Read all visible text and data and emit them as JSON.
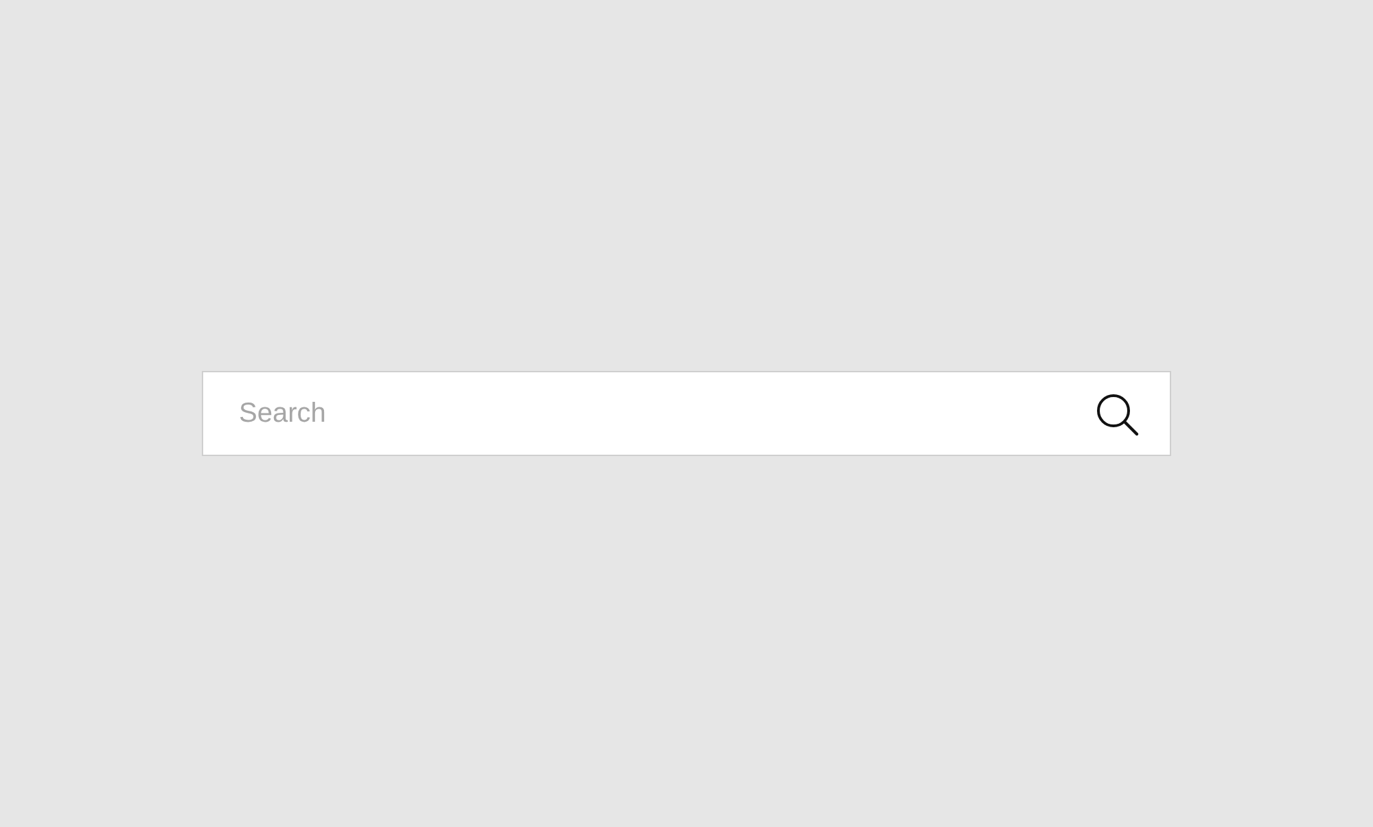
{
  "search": {
    "placeholder": "Search"
  }
}
